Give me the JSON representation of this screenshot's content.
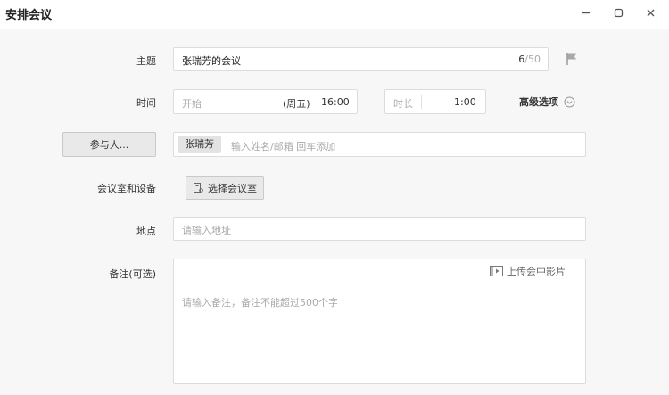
{
  "window": {
    "title": "安排会议",
    "minimize_icon": "minimize-icon",
    "maximize_icon": "maximize-icon",
    "close_icon": "close-icon"
  },
  "subject": {
    "label": "主题",
    "value": "张瑞芳的会议",
    "count_used": "6",
    "count_max": "/50",
    "flag_icon": "flag-icon"
  },
  "time": {
    "label": "时间",
    "start_label": "开始",
    "weekday": "(周五)",
    "start_time": "16:00",
    "duration_label": "时长",
    "duration_value": "1:00",
    "advanced_label": "高级选项",
    "advanced_icon": "chevron-down-circle-icon"
  },
  "participants": {
    "button_label": "参与人...",
    "chip": "张瑞芳",
    "placeholder": "输入姓名/邮箱 回车添加"
  },
  "room": {
    "label": "会议室和设备",
    "button_label": "选择会议室",
    "button_icon": "room-icon"
  },
  "location": {
    "label": "地点",
    "placeholder": "请输入地址"
  },
  "notes": {
    "label": "备注(可选)",
    "upload_label": "上传会中影片",
    "upload_icon": "video-upload-icon",
    "placeholder": "请输入备注，备注不能超过500个字"
  }
}
